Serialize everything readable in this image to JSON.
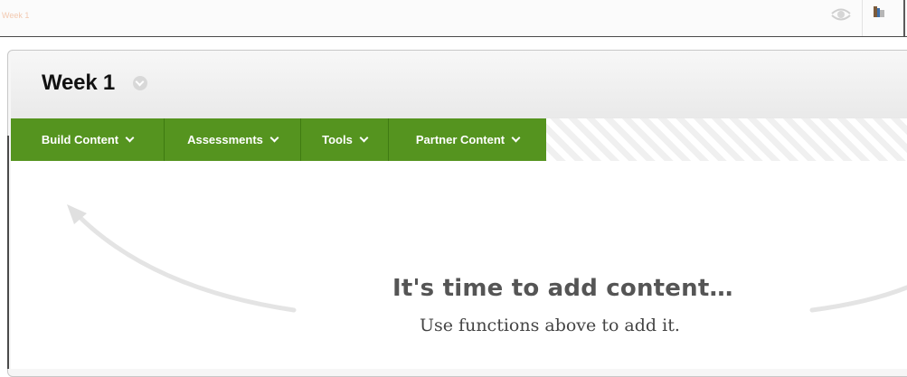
{
  "topbar": {
    "faint_label": "Week 1",
    "icons": [
      "eye-icon",
      "flag-icon"
    ]
  },
  "page": {
    "title": "Week 1"
  },
  "action_bar": {
    "items": [
      {
        "label": "Build Content"
      },
      {
        "label": "Assessments"
      },
      {
        "label": "Tools"
      },
      {
        "label": "Partner Content"
      }
    ],
    "accent_color": "#55941f"
  },
  "empty_state": {
    "title": "It's time to add content…",
    "subtitle": "Use functions above to add it."
  }
}
